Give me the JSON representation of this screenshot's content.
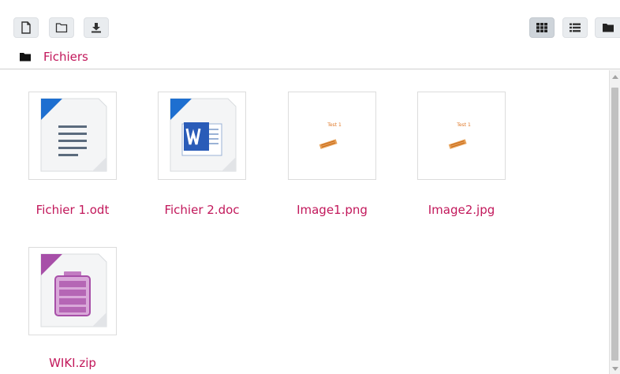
{
  "toolbar": {
    "left_buttons": [
      {
        "name": "new-file-button",
        "icon": "file-icon"
      },
      {
        "name": "new-folder-button",
        "icon": "folder-icon"
      },
      {
        "name": "download-button",
        "icon": "download-icon"
      }
    ],
    "view_buttons": [
      {
        "name": "grid-view-button",
        "icon": "grid-icon",
        "active": true
      },
      {
        "name": "list-view-button",
        "icon": "list-icon",
        "active": false
      },
      {
        "name": "tree-view-button",
        "icon": "folder-icon",
        "active": false
      }
    ]
  },
  "breadcrumb": {
    "icon": "folder-icon",
    "label": "Fichiers"
  },
  "files": [
    {
      "name": "Fichier 1.odt",
      "type": "odt-document",
      "icon": "document-icon"
    },
    {
      "name": "Fichier 2.doc",
      "type": "word-document",
      "icon": "word-icon"
    },
    {
      "name": "Image1.png",
      "type": "image",
      "icon": "image-thumbnail",
      "thumb_text": "Test 1"
    },
    {
      "name": "Image2.jpg",
      "type": "image",
      "icon": "image-thumbnail",
      "thumb_text": "Test 1"
    },
    {
      "name": "WIKI.zip",
      "type": "archive",
      "icon": "archive-icon"
    }
  ],
  "colors": {
    "link": "#c2185b",
    "active_button": "#ced4da",
    "button": "#e9ecef",
    "doc_blue": "#1e6fd0",
    "zip_purple": "#a74fa8"
  }
}
